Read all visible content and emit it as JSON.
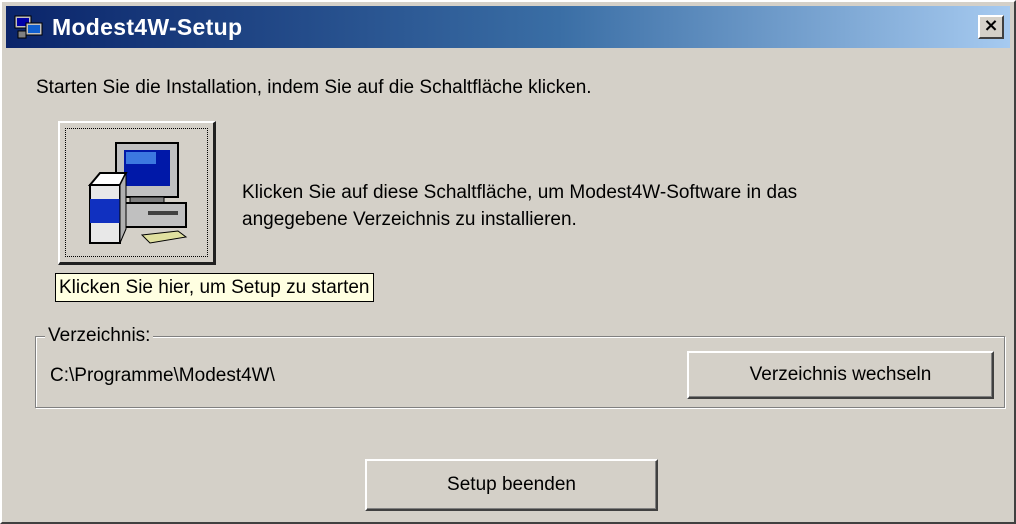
{
  "window": {
    "title": "Modest4W-Setup",
    "close_glyph": "×"
  },
  "instruction": "Starten Sie die Installation, indem Sie auf die Schaltfläche klicken.",
  "setup_button": {
    "icon": "computer-install-icon",
    "description_line1": "Klicken Sie auf diese Schaltfläche, um Modest4W-Software in das",
    "description_line2": "angegebene Verzeichnis zu installieren."
  },
  "tooltip": "Klicken Sie hier, um Setup zu starten",
  "directory_group": {
    "label": "Verzeichnis:",
    "path": "C:\\Programme\\Modest4W\\",
    "change_button_label": "Verzeichnis wechseln"
  },
  "finish_button_label": "Setup beenden",
  "colors": {
    "window_face": "#d4d0c8",
    "title_gradient_start": "#0a246a",
    "title_gradient_end": "#a6caf0",
    "tooltip_background": "#ffffe1"
  }
}
